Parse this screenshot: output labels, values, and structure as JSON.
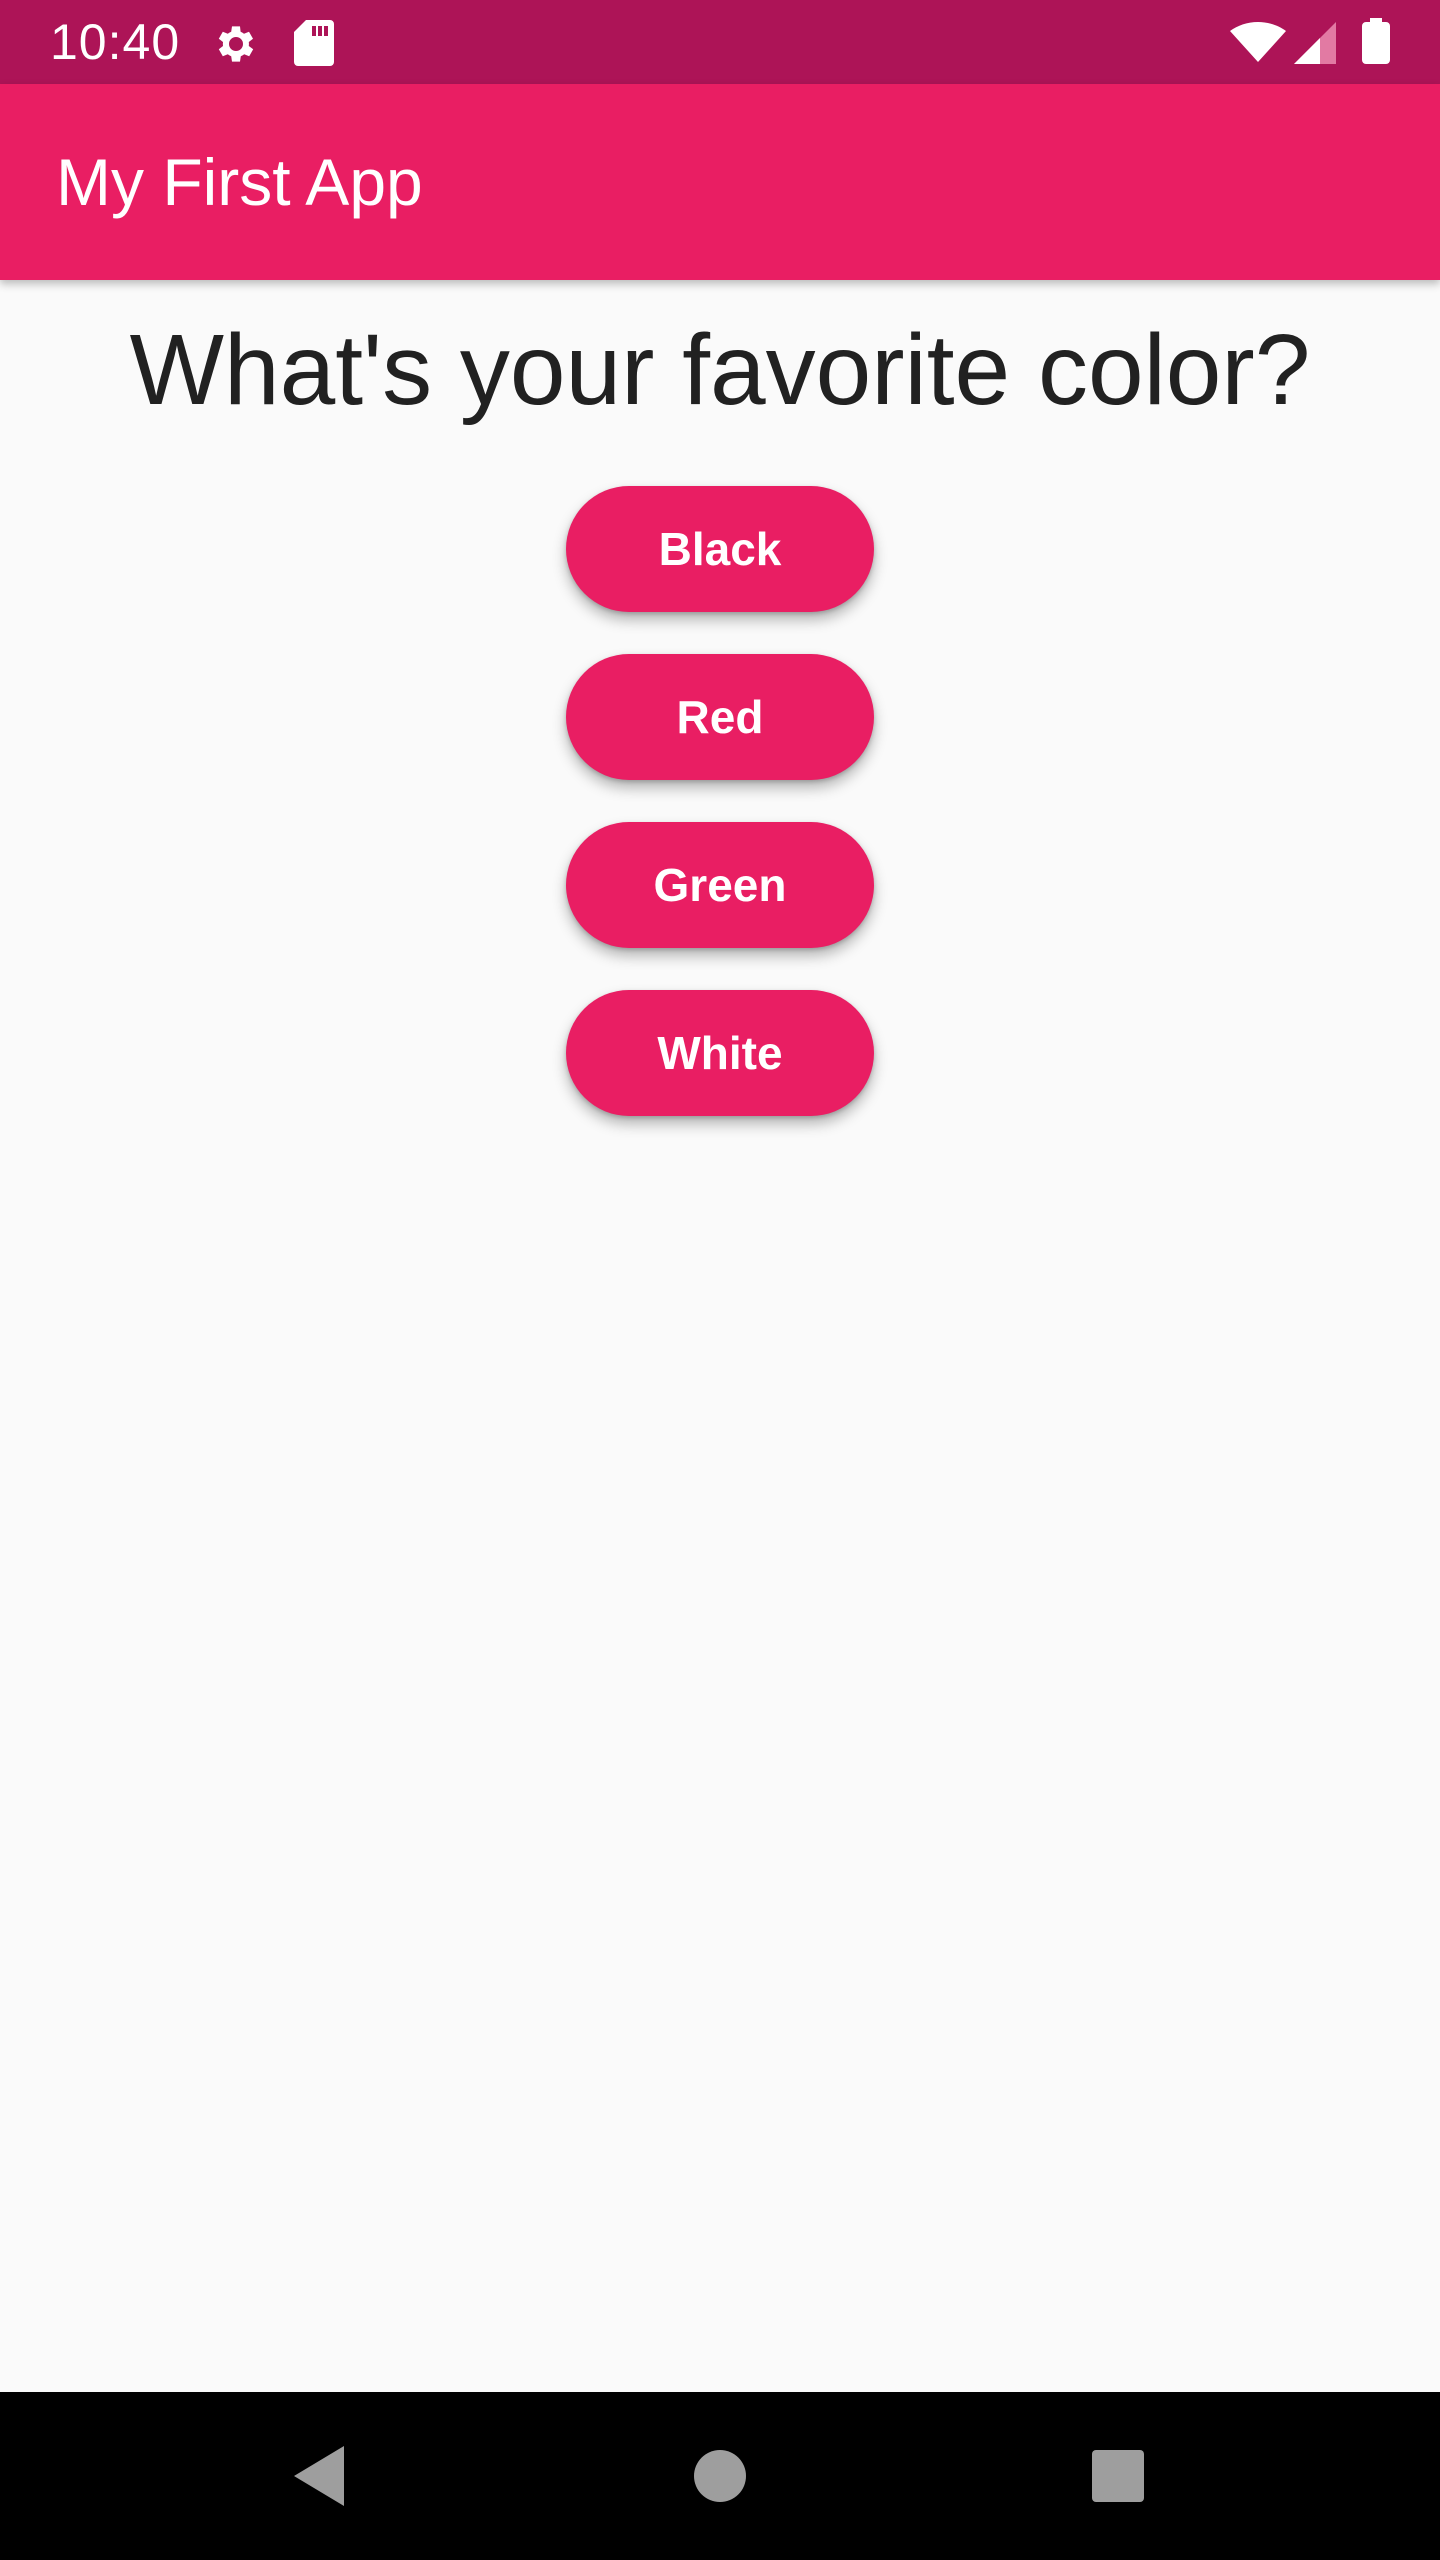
{
  "status_bar": {
    "time": "10:40",
    "icons": [
      "gear-icon",
      "sd-card-icon",
      "wifi-icon",
      "cell-signal-icon",
      "battery-icon"
    ]
  },
  "app_bar": {
    "title": "My First App"
  },
  "main": {
    "question": "What's your favorite color?",
    "buttons": [
      {
        "label": "Black"
      },
      {
        "label": "Red"
      },
      {
        "label": "Green"
      },
      {
        "label": "White"
      }
    ]
  },
  "nav_bar": {
    "icons": [
      "back-icon",
      "home-icon",
      "recents-icon"
    ]
  },
  "colors": {
    "status_bar": "#ad1457",
    "primary": "#e91e63",
    "background": "#fafafa",
    "text": "#212121",
    "nav_bar": "#000000"
  }
}
